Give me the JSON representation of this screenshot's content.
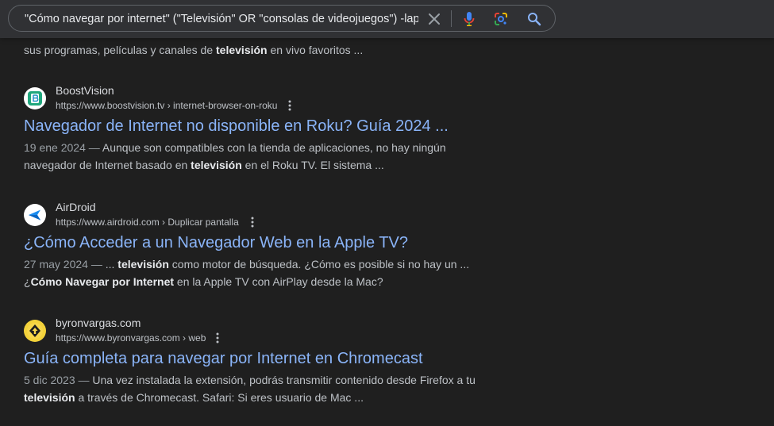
{
  "search": {
    "query": "\"Cómo navegar por internet\" (\"Televisión\" OR \"consolas de videojuegos\") -lapto"
  },
  "icons": {
    "clear": "close-icon",
    "voice": "microphone-icon",
    "lens": "google-lens-icon",
    "search": "search-icon"
  },
  "partial_result": {
    "text_before": "sus programas, películas y canales de ",
    "bold": "televisión",
    "text_after": " en vivo favoritos ..."
  },
  "results": [
    {
      "site_name": "BoostVision",
      "url": "https://www.boostvision.tv › internet-browser-on-roku",
      "title": "Navegador de Internet no disponible en Roku? Guía 2024 ...",
      "date": "19 ene 2024",
      "dash": " — ",
      "s1": "Aunque son compatibles con la tienda de aplicaciones, no hay ningún navegador de Internet basado en ",
      "b1": "televisión",
      "s2": " en el Roku TV. El sistema ...",
      "b2": "",
      "s3": "",
      "favicon_color": "#2aa889"
    },
    {
      "site_name": "AirDroid",
      "url": "https://www.airdroid.com › Duplicar pantalla",
      "title": "¿Cómo Acceder a un Navegador Web en la Apple TV?",
      "date": "27 may 2024",
      "dash": " — ",
      "s1": "... ",
      "b1": "televisión",
      "s2": " como motor de búsqueda. ¿Cómo es posible si no hay un ... ¿",
      "b2": "Cómo Navegar por Internet",
      "s3": " en la Apple TV con AirPlay desde la Mac?",
      "favicon_color": "#1a73e8"
    },
    {
      "site_name": "byronvargas.com",
      "url": "https://www.byronvargas.com › web",
      "title": "Guía completa para navegar por Internet en Chromecast",
      "date": "5 dic 2023",
      "dash": " — ",
      "s1": "Una vez instalada la extensión, podrás transmitir contenido desde Firefox a tu ",
      "b1": "televisión",
      "s2": " a través de Chromecast. Safari: Si eres usuario de Mac ...",
      "b2": "",
      "s3": "",
      "favicon_color": "#f3c623"
    }
  ]
}
